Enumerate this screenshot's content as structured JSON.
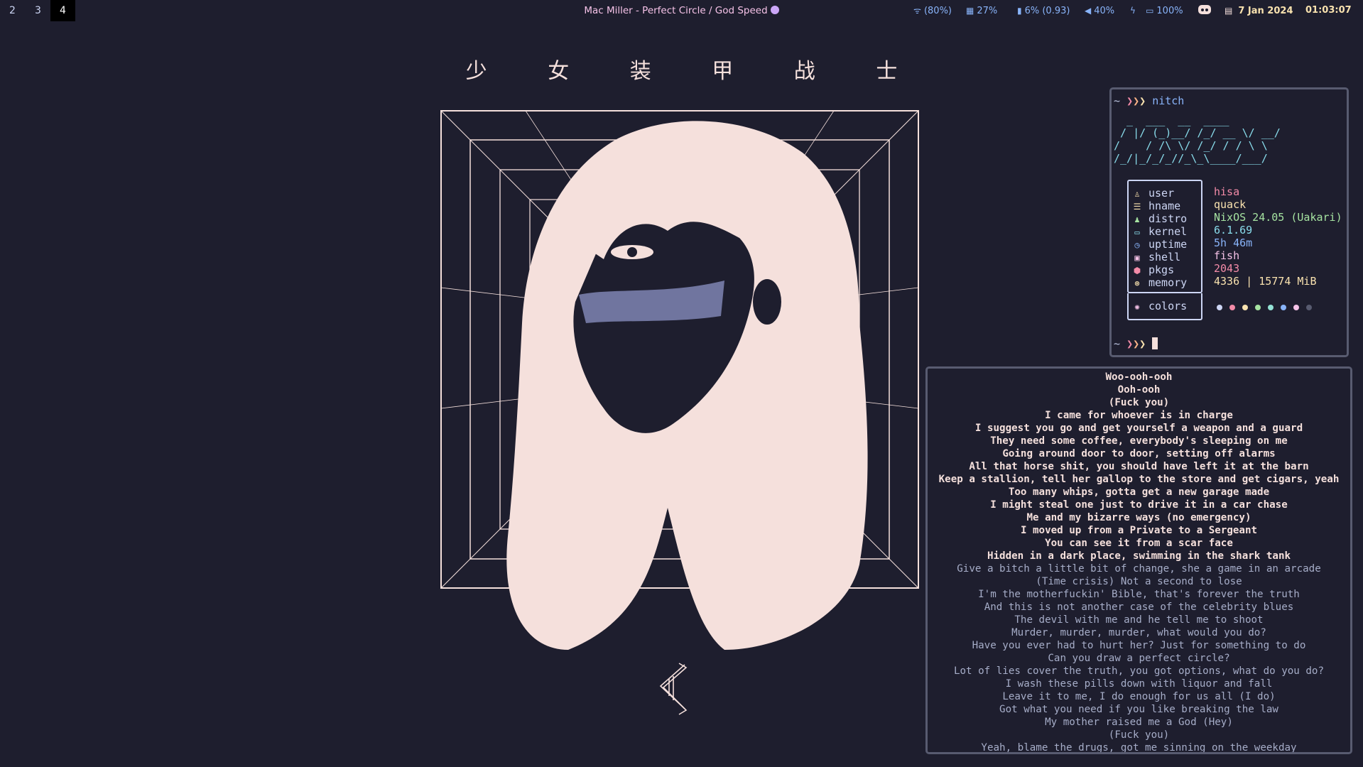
{
  "workspaces": [
    {
      "label": "2",
      "active": false
    },
    {
      "label": "3",
      "active": false
    },
    {
      "label": "4",
      "active": true
    }
  ],
  "now_playing": "Mac Miller - Perfect Circle / God Speed",
  "status": {
    "wifi": "(80%)",
    "cpu": "27%",
    "memory": "6% (0.93)",
    "volume": "40%",
    "battery": "100%",
    "date": "7 Jan 2024",
    "time": "01:03:07"
  },
  "status_icons": [
    "wifi-icon",
    "cpu-icon",
    "memory-icon",
    "volume-icon",
    "charging-icon",
    "battery-icon",
    "discord-icon",
    "calendar-icon"
  ],
  "title": "少 女 装 甲 战 士",
  "colors": {
    "bg": "#1e1e2e",
    "art": "#f5e0dc",
    "border": "#585b70",
    "pink": "#f38ba8",
    "yellow": "#f9e2af",
    "blue": "#89b4fa",
    "teal": "#89dceb",
    "mauve": "#cba6f7"
  },
  "terminal": {
    "prompt": "~ ❯❯❯",
    "command": "nitch",
    "ascii": "  _  ___  __  ____\n / |/ (_)__/ /_/ __ \\/ __/\n/    / /\\ \\/ /_/ / / \\ \\\n/_/|_/_/_//_\\_\\____/___/",
    "info": [
      {
        "icon": "user-icon",
        "key": "user",
        "value": "hisa",
        "color": "#f38ba8"
      },
      {
        "icon": "hostname-icon",
        "key": "hname",
        "value": "quack",
        "color": "#f9e2af"
      },
      {
        "icon": "distro-icon",
        "key": "distro",
        "value": "NixOS 24.05 (Uakari)",
        "color": "#a6e3a1"
      },
      {
        "icon": "kernel-icon",
        "key": "kernel",
        "value": "6.1.69",
        "color": "#89dceb"
      },
      {
        "icon": "uptime-icon",
        "key": "uptime",
        "value": "5h 46m",
        "color": "#89b4fa"
      },
      {
        "icon": "shell-icon",
        "key": "shell",
        "value": "fish",
        "color": "#f5c2e7"
      },
      {
        "icon": "package-icon",
        "key": "pkgs",
        "value": "2043",
        "color": "#f38ba8"
      },
      {
        "icon": "memory-chip-icon",
        "key": "memory",
        "value": "4336 | 15774 MiB",
        "color": "#f9e2af"
      }
    ],
    "colors_label": "colors",
    "palette": [
      "#cdd6f4",
      "#f38ba8",
      "#f9e2af",
      "#a6e3a1",
      "#94e2d5",
      "#89b4fa",
      "#f5c2e7",
      "#585b70"
    ]
  },
  "lyrics_sung": [
    "Woo-ooh-ooh",
    "Ooh-ooh",
    "(Fuck you)",
    "I came for whoever is in charge",
    "I suggest you go and get yourself a weapon and a guard",
    "They need some coffee, everybody's sleeping on me",
    "Going around door to door, setting off alarms",
    "All that horse shit, you should have left it at the barn",
    "Keep a stallion, tell her gallop to the store and get cigars, yeah",
    "Too many whips, gotta get a new garage made",
    "I might steal one just to drive it in a car chase",
    "Me and my bizarre ways (no emergency)",
    "I moved up from a Private to a Sergeant",
    "You can see it from a scar face",
    "Hidden in a dark place, swimming in the shark tank"
  ],
  "lyrics_upcoming": [
    "Give a bitch a little bit of change, she a game in an arcade",
    "(Time crisis) Not a second to lose",
    "I'm the motherfuckin' Bible, that's forever the truth",
    "And this is not another case of the celebrity blues",
    "The devil with me and he tell me to shoot",
    "Murder, murder, murder, what would you do?",
    "Have you ever had to hurt her? Just for something to do",
    "Can you draw a perfect circle?",
    "Lot of lies cover the truth, you got options, what do you do?",
    "I wash these pills down with liquor and fall",
    "Leave it to me, I do enough for us all (I do)",
    "Got what you need if you like breaking the law",
    "My mother raised me a God (Hey)",
    "(Fuck you)",
    "Yeah, blame the drugs, got me sinning on the weekday"
  ]
}
